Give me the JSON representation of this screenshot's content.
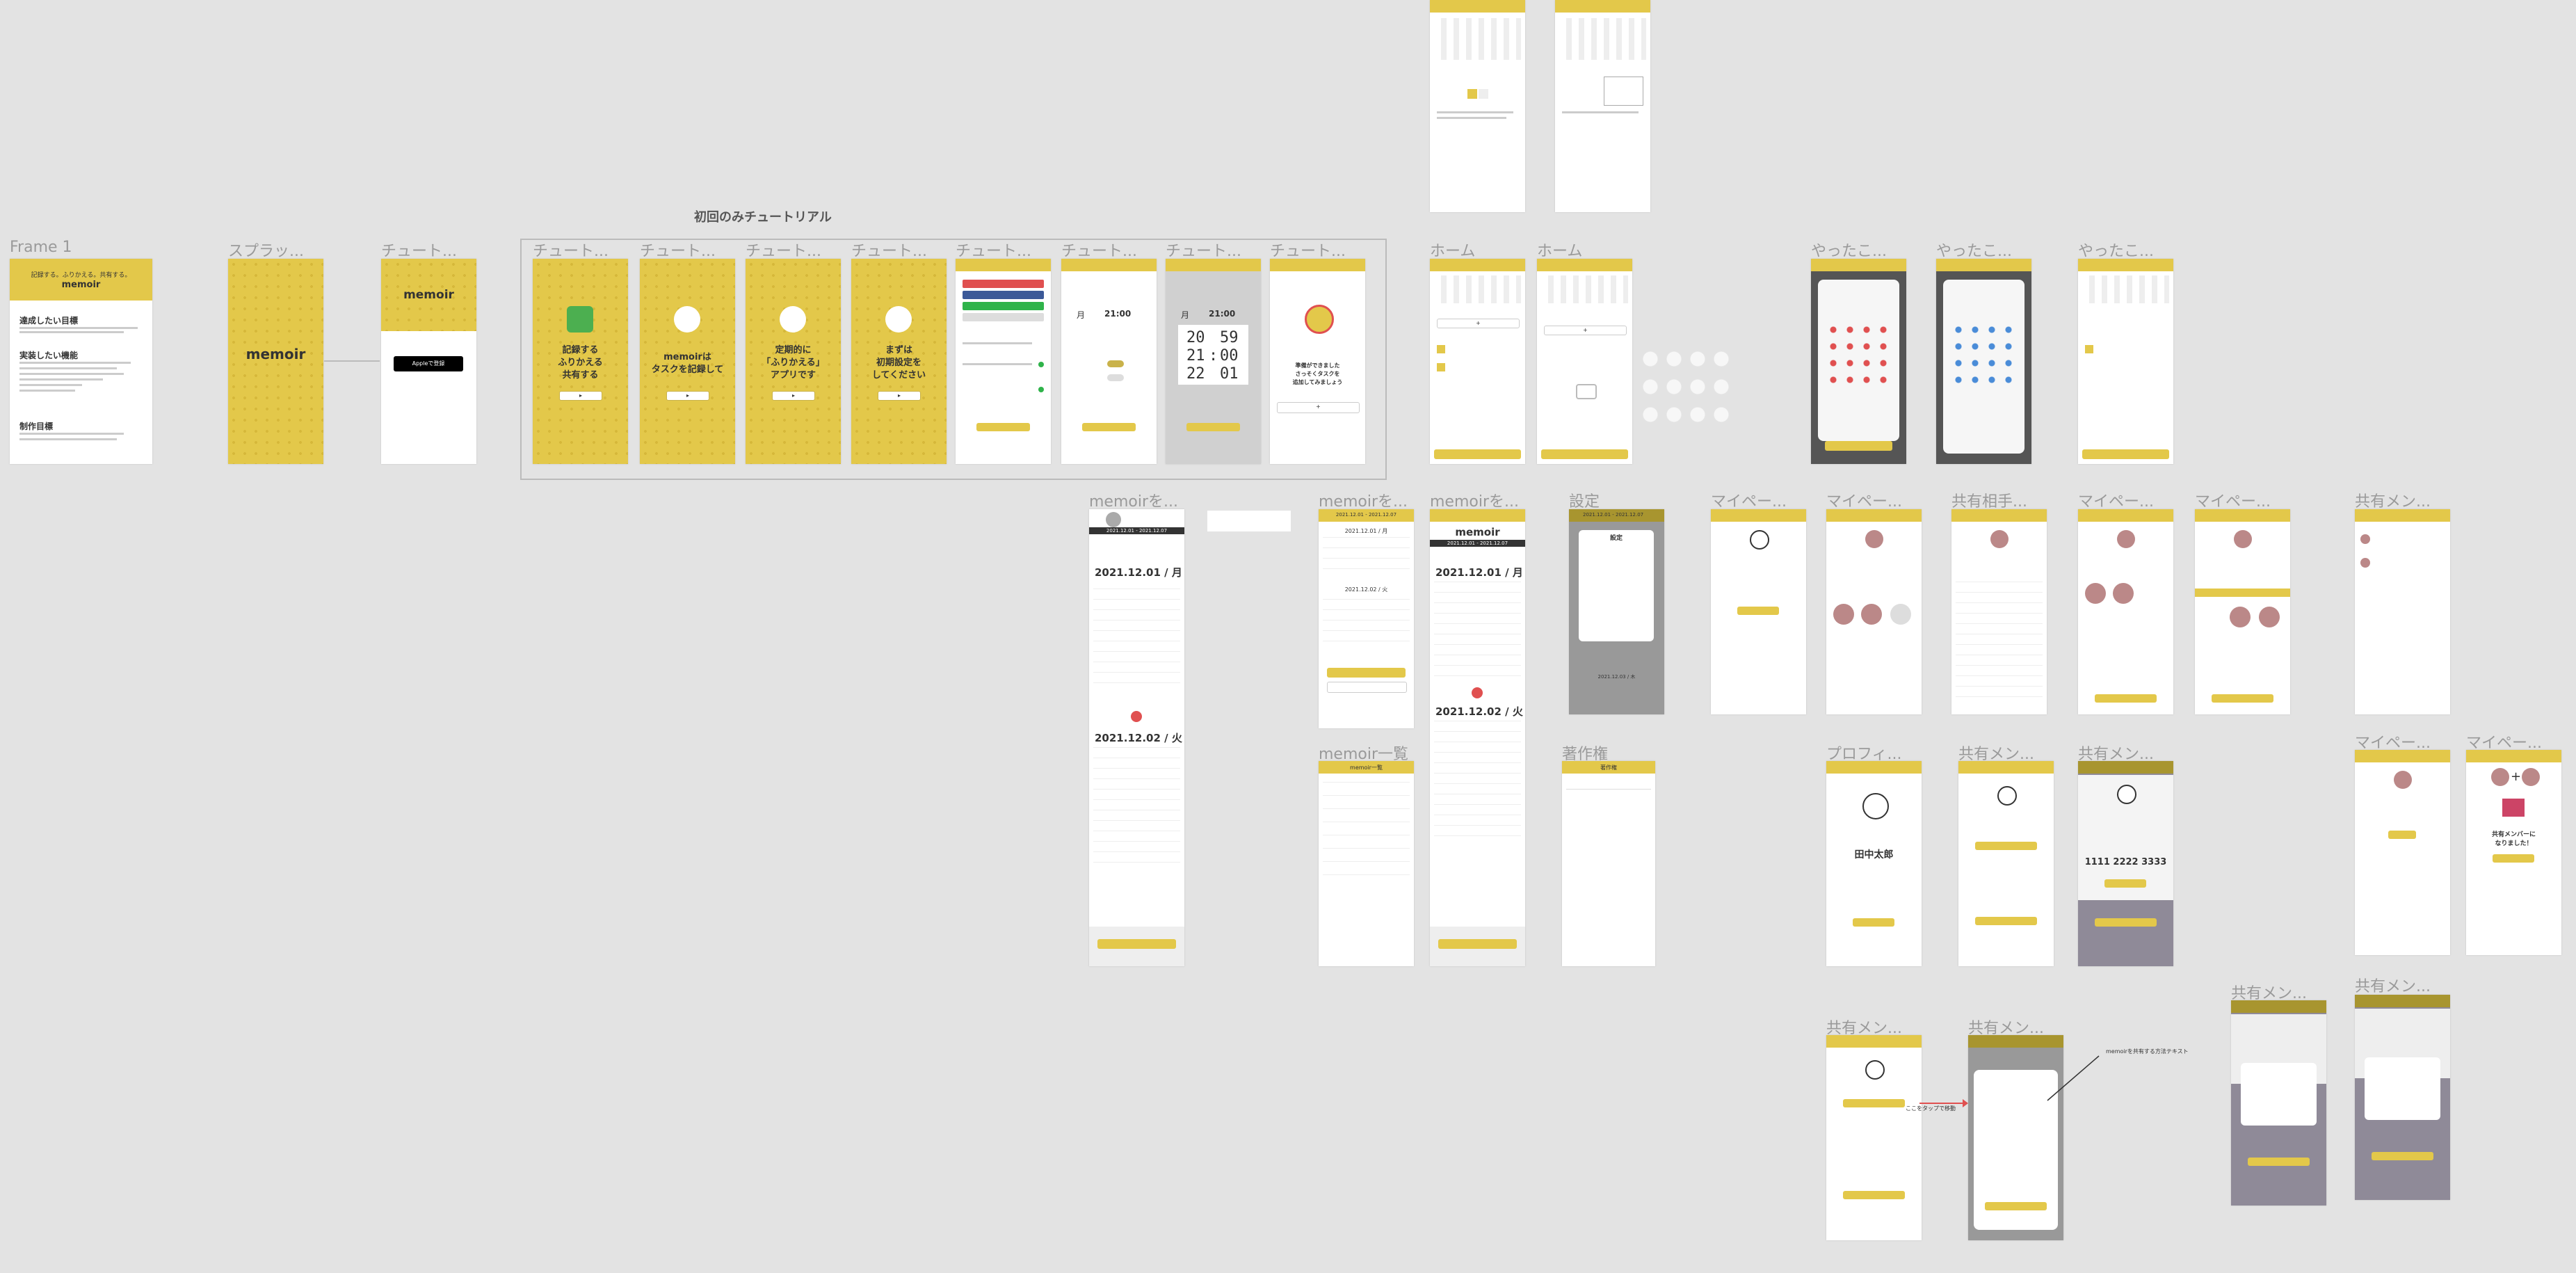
{
  "canvas": {
    "background": "#e3e3e3",
    "accent": "#e3c84a"
  },
  "group_title": "初回のみチュートリアル",
  "labels": {
    "frame1": "Frame 1",
    "splash": "スプラッ...",
    "tut": "チュート...",
    "home": "ホーム",
    "yatta": "やったこ...",
    "memoir_wo": "memoirを...",
    "settings": "設定",
    "mypage": "マイペー...",
    "share_partner": "共有相手...",
    "share_member": "共有メン...",
    "memoir_list": "memoir一覧",
    "copyright": "著作権",
    "profile": "プロフィ..."
  },
  "frame1": {
    "tagline": "記録する。ふりかえる。共有する。",
    "logo": "memoir",
    "h1": "達成したい目標",
    "h2": "実装したい機能",
    "h3": "制作目標"
  },
  "splash": {
    "logo": "memoir"
  },
  "tut0": {
    "logo": "memoir",
    "apple": "Appleで登録"
  },
  "tutorial_texts": [
    {
      "lines": [
        "記録する",
        "ふりかえる",
        "共有する"
      ],
      "icon": "book-icon"
    },
    {
      "lines": [
        "memoirは",
        "タスクを記録して"
      ],
      "icon": "pen-icon"
    },
    {
      "lines": [
        "定期的に",
        "「ふりかえる」",
        "アプリです"
      ],
      "icon": "head-icon"
    },
    {
      "lines": [
        "まずは",
        "初期設定を",
        "してください"
      ],
      "icon": "gear-icon"
    }
  ],
  "time_picker": {
    "rows": [
      [
        "20",
        "59"
      ],
      [
        "21",
        "00"
      ],
      [
        "22",
        "01"
      ]
    ],
    "sep": ":"
  },
  "weekday_time": {
    "day": "月",
    "time": "21:00"
  },
  "ready_text": [
    "準備ができました",
    "さっそくタスクを",
    "追加してみましょう"
  ],
  "memoir_detail": {
    "range": "2021.12.01 - 2021.12.07",
    "day1": "2021.12.01 / 月",
    "day2": "2021.12.02 / 火",
    "title": "memoir"
  },
  "memoir_small": {
    "range": "2021.12.01 - 2021.12.07",
    "d1": "2021.12.01 / 月",
    "d2": "2021.12.02 / 火"
  },
  "settings_menu": {
    "title": "設定",
    "range": "2021.12.01 - 2021.12.07",
    "date": "2021.12.03 / 木"
  },
  "memoir_list_title": "memoir一覧",
  "copyright_title": "著作権",
  "profile": {
    "name": "田中太郎"
  },
  "share_code": {
    "code": "1111 2222 3333"
  },
  "share_plus": {
    "text": "共有メンバーに\nなりました！"
  },
  "annotation": {
    "arrow_text": "ここをタップで移動",
    "note": "memoirを共有する方法テキスト"
  }
}
